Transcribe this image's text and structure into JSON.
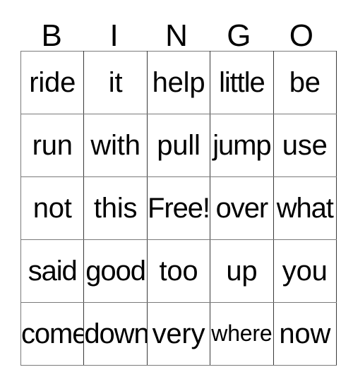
{
  "card": {
    "title": "BINGO",
    "headers": [
      "B",
      "I",
      "N",
      "G",
      "O"
    ],
    "free_space_label": "Free!",
    "rows": [
      [
        "ride",
        "it",
        "help",
        "little",
        "be"
      ],
      [
        "run",
        "with",
        "pull",
        "jump",
        "use"
      ],
      [
        "not",
        "this",
        "Free!",
        "over",
        "what"
      ],
      [
        "said",
        "good",
        "too",
        "up",
        "you"
      ],
      [
        "come",
        "down",
        "very",
        "where",
        "now"
      ]
    ],
    "colors": {
      "background": "#ffffff",
      "text": "#000000",
      "grid_line": "#3a3a3a",
      "grid_line_light": "#7a7a7a"
    }
  }
}
